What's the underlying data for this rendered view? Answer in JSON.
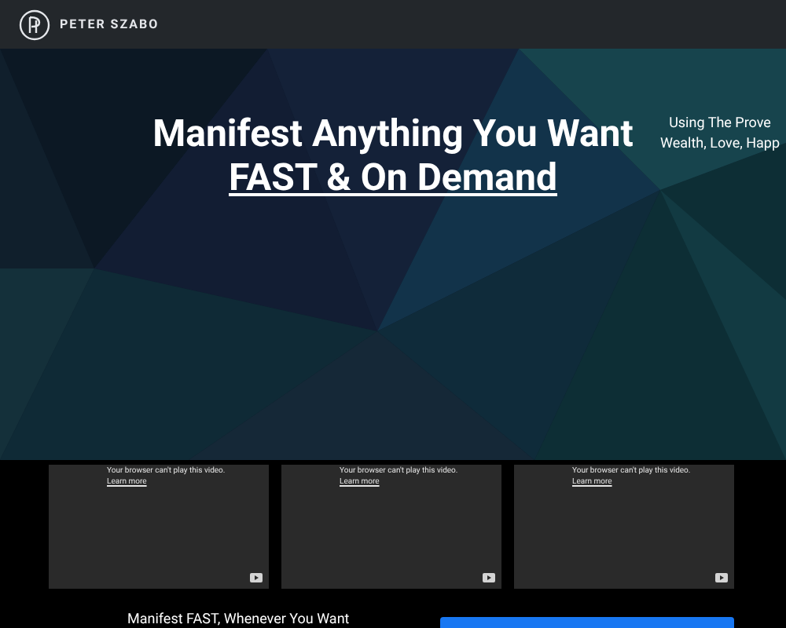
{
  "header": {
    "logo_text": "PETER SZABO"
  },
  "hero": {
    "title_line_1": "Manifest Anything You Want",
    "title_line_2": "FAST & On Demand",
    "side_lines": [
      "Using The Prove",
      "Wealth, Love, Happ"
    ]
  },
  "videos": [
    {
      "message": "Your browser can't play this video.",
      "link": "Learn more"
    },
    {
      "message": "Your browser can't play this video.",
      "link": "Learn more"
    },
    {
      "message": "Your browser can't play this video.",
      "link": "Learn more"
    }
  ],
  "footer_heading": "Manifest FAST, Whenever You Want"
}
